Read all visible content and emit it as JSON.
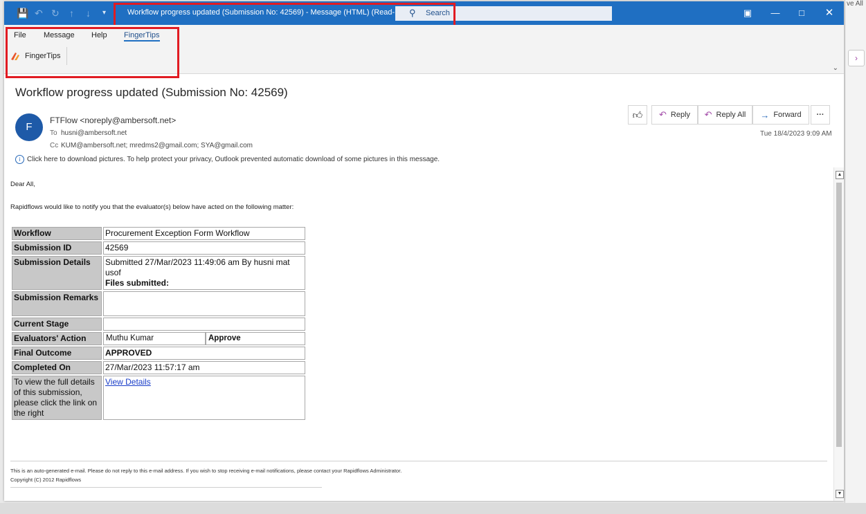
{
  "background": {
    "top_right_text": "ve All",
    "right_icons": [
      "right-arrow-icon",
      "purple-dot-icon"
    ]
  },
  "titlebar": {
    "title": "Workflow progress updated (Submission No: 42569)  -  Message (HTML) (Read-...",
    "search_label": "Search",
    "bg_color": "#1f6fc2"
  },
  "menu": {
    "items": [
      "File",
      "Message",
      "Help",
      "FingerTips"
    ],
    "active": "FingerTips"
  },
  "ribbon": {
    "fingertips_button": "FingerTips"
  },
  "email": {
    "subject": "Workflow progress updated (Submission No: 42569)",
    "avatar_letter": "F",
    "sender": "FTFlow <noreply@ambersoft.net>",
    "to_label": "To",
    "to": "husni@ambersoft.net",
    "cc_label": "Cc",
    "cc": "KUM@ambersoft.net; mredms2@gmail.com; SYA@gmail.com",
    "privacy_notice": "Click here to download pictures. To help protect your privacy, Outlook prevented automatic download of some pictures in this message.",
    "date": "Tue 18/4/2023 9:09 AM",
    "actions": {
      "reply": "Reply",
      "reply_all": "Reply All",
      "forward": "Forward",
      "more": "···"
    }
  },
  "body": {
    "greeting": "Dear All,",
    "intro": "Rapidflows would like to notify you that the evaluator(s) below have acted on the following matter:",
    "table": {
      "workflow_label": "Workflow",
      "workflow_value": "Procurement Exception Form Workflow",
      "submission_id_label": "Submission ID",
      "submission_id_value": "42569",
      "details_label": "Submission Details",
      "details_value": "Submitted 27/Mar/2023 11:49:06 am By husni mat usof",
      "files_label": "Files submitted:",
      "remarks_label": "Submission Remarks",
      "remarks_value": "",
      "stage_label": "Current Stage",
      "stage_value": "",
      "evaluators_label": "Evaluators' Action",
      "evaluator_name": "Muthu Kumar",
      "evaluator_action": "Approve",
      "outcome_label": "Final Outcome",
      "outcome_value": "APPROVED",
      "completed_label": "Completed On",
      "completed_value": "27/Mar/2023 11:57:17 am",
      "view_label": "To view the full details of this submission, please click the link on the right",
      "view_link": "View Details"
    },
    "footer_line1": "This is an auto-generated e-mail. Please do not reply to this e-mail address. If you wish to stop receiving e-mail notifications, please contact your Rapidflows Administrator.",
    "footer_line2": "Copyright (C) 2012 Rapidflows"
  }
}
